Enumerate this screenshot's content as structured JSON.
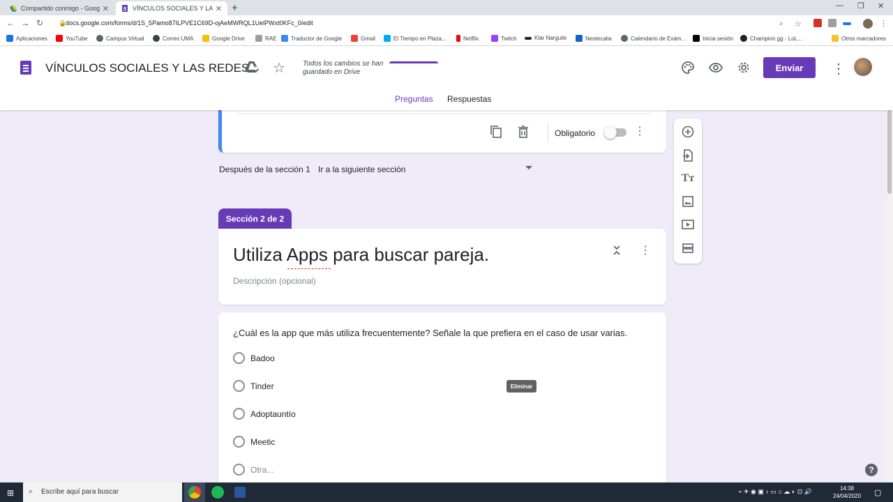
{
  "browser": {
    "tabs": [
      {
        "label": "Compartido conmigo - Google D",
        "active": false,
        "icon": "google-drive-icon"
      },
      {
        "label": "VÍNCULOS SOCIALES Y LAS REDE",
        "active": true,
        "icon": "google-forms-icon"
      }
    ],
    "new_tab": "+",
    "url": "docs.google.com/forms/d/1S_5Pamo87ILPVE1C69D-ojAeMWRQL1UelPWxt0KFc_0/edit",
    "bookmarks": [
      "Aplicaciones",
      "YouTube",
      "Campus Virtual",
      "Correo UMA",
      "Google Drive",
      "RAE",
      "Traductor de Google",
      "Gmail",
      "El Tiempo en Plaza...",
      "Netflix",
      "Twitch",
      "Klar Narguile",
      "Neotecalia",
      "Calendario de Exám...",
      "Inicia sesión",
      "Champion.gg - LoL..."
    ],
    "other_bookmarks": "Otros marcadores"
  },
  "header": {
    "doc_title": "VÍNCULOS SOCIALES Y LAS REDES",
    "save_status_line1": "Todos los cambios se han",
    "save_status_line2": "guardado en Drive",
    "send_label": "Enviar",
    "tabs": [
      {
        "label": "Preguntas",
        "active": true
      },
      {
        "label": "Respuestas",
        "active": false
      }
    ]
  },
  "question_footer": {
    "required_label": "Obligatorio",
    "required": false
  },
  "navigation": {
    "after_section_label": "Después de la sección 1",
    "goto_value": "Ir a la siguiente sección"
  },
  "section": {
    "badge": "Sección 2 de 2",
    "title": "Utiliza Apps para buscar pareja.",
    "description_placeholder": "Descripción (opcional)"
  },
  "question": {
    "text": "¿Cuál es la app que más utiliza frecuentemente? Señale la que prefiera en el caso de usar varias.",
    "options": [
      "Badoo",
      "Tinder",
      "Adoptauntío",
      "Meetic"
    ],
    "other_option": "Otra...",
    "tooltip": "Eliminar"
  },
  "taskbar": {
    "search_placeholder": "Escribe aquí para buscar",
    "time": "14:38",
    "date": "24/04/2020"
  },
  "colors": {
    "accent": "#673ab7",
    "page_bg": "#f0ebf8",
    "focus_border": "#4285f4"
  }
}
